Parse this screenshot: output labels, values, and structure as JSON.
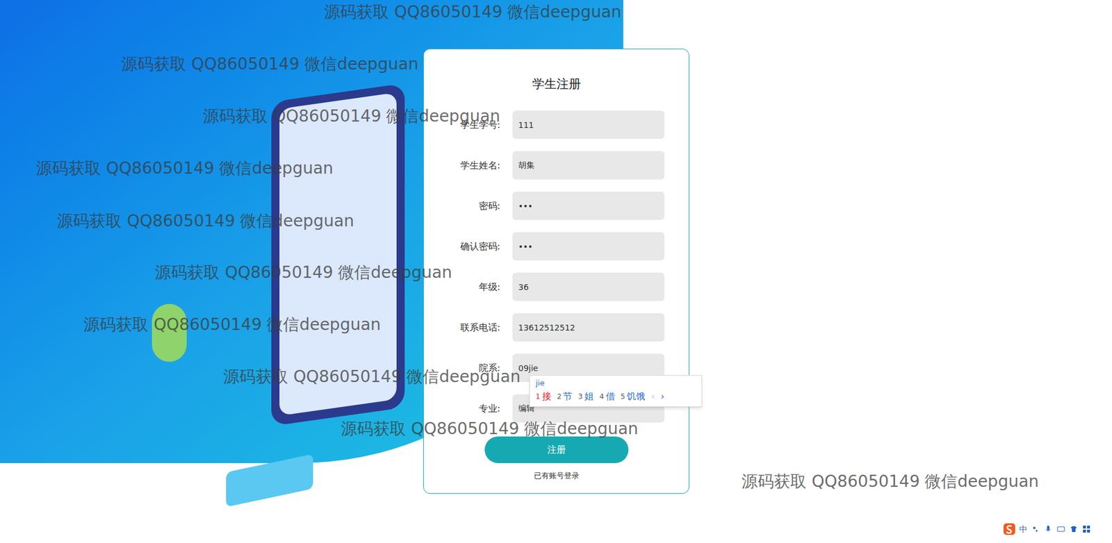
{
  "watermarks": [
    "源码获取 QQ86050149 微信deepguan",
    "源码获取 QQ86050149 微信deepguan",
    "源码获取 QQ86050149 微信deepguan",
    "源码获取 QQ86050149 微信deepguan",
    "源码获取 QQ86050149 微信deepguan",
    "源码获取 QQ86050149 微信deepguan",
    "源码获取 QQ86050149 微信deepguan",
    "源码获取 QQ86050149 微信deepguan",
    "源码获取 QQ86050149 微信deepguan",
    "源码获取 QQ86050149 微信deepguan"
  ],
  "form": {
    "title": "学生注册",
    "fields": [
      {
        "label": "学生学号:",
        "value": "111"
      },
      {
        "label": "学生姓名:",
        "value": "胡集"
      },
      {
        "label": "密码:",
        "value": "•••"
      },
      {
        "label": "确认密码:",
        "value": "•••"
      },
      {
        "label": "年级:",
        "value": "36"
      },
      {
        "label": "联系电话:",
        "value": "13612512512"
      },
      {
        "label": "院系:",
        "value": "09jie"
      },
      {
        "label": "专业:",
        "value": "编辑"
      }
    ],
    "submit": "注册",
    "login_link": "已有账号登录"
  },
  "ime": {
    "composition": "jie",
    "candidates": [
      {
        "index": "1",
        "text": "接",
        "selected": true
      },
      {
        "index": "2",
        "text": "节",
        "selected": false
      },
      {
        "index": "3",
        "text": "姐",
        "selected": false
      },
      {
        "index": "4",
        "text": "借",
        "selected": false
      },
      {
        "index": "5",
        "text": "饥饿",
        "selected": false
      }
    ],
    "prev": {
      "text": "‹",
      "disabled": true
    },
    "next": {
      "text": "›",
      "disabled": false
    }
  },
  "taskbar": {
    "ime_mode": "中"
  }
}
